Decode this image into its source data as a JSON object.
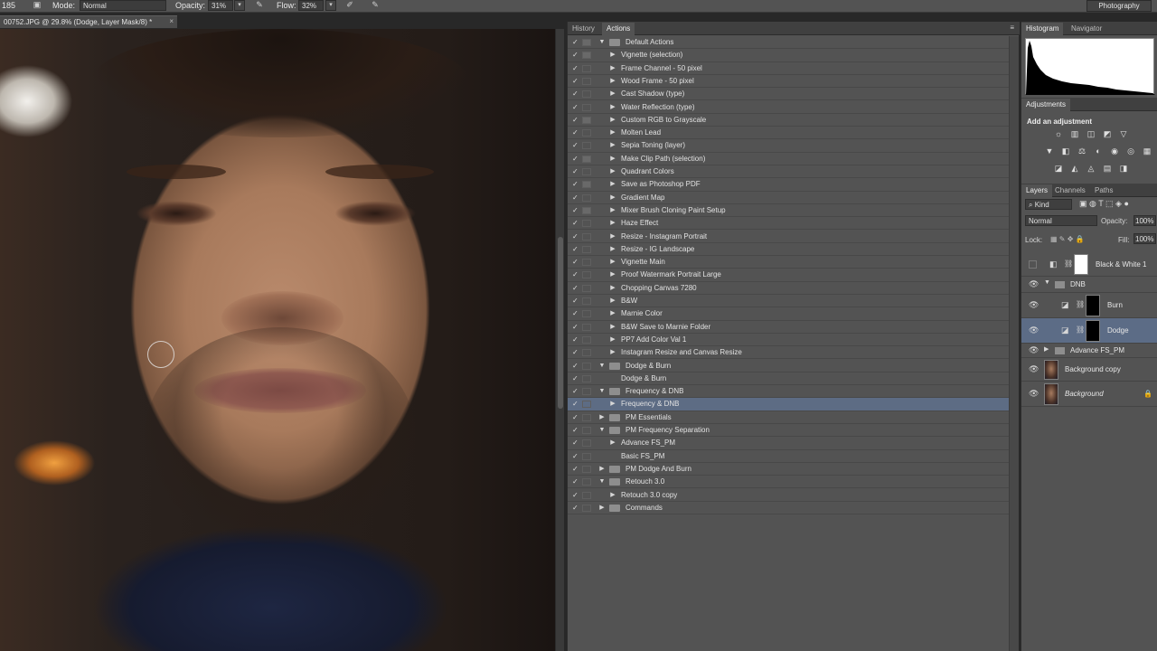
{
  "options_bar": {
    "brush_size": "185",
    "mode_label": "Mode:",
    "mode_value": "Normal",
    "opacity_label": "Opacity:",
    "opacity_value": "31%",
    "flow_label": "Flow:",
    "flow_value": "32%",
    "workspace": "Photography"
  },
  "document": {
    "tab_title": "00752.JPG @ 29.8% (Dodge, Layer Mask/8) *",
    "close": "×"
  },
  "actions_panel": {
    "tabs": [
      "History",
      "Actions"
    ],
    "active_tab": "Actions",
    "menu_icon": "≡",
    "rows": [
      {
        "label": "Default Actions",
        "type": "set",
        "expanded": true,
        "dialog": true
      },
      {
        "label": "Vignette (selection)",
        "type": "action",
        "dialog": true
      },
      {
        "label": "Frame Channel - 50 pixel",
        "type": "action",
        "dialog": false
      },
      {
        "label": "Wood Frame - 50 pixel",
        "type": "action",
        "dialog": false
      },
      {
        "label": "Cast Shadow (type)",
        "type": "action",
        "dialog": false
      },
      {
        "label": "Water Reflection (type)",
        "type": "action",
        "dialog": false
      },
      {
        "label": "Custom RGB to Grayscale",
        "type": "action",
        "dialog": true
      },
      {
        "label": "Molten Lead",
        "type": "action",
        "dialog": false
      },
      {
        "label": "Sepia Toning (layer)",
        "type": "action",
        "dialog": false
      },
      {
        "label": "Make Clip Path (selection)",
        "type": "action",
        "dialog": true
      },
      {
        "label": "Quadrant Colors",
        "type": "action",
        "dialog": false
      },
      {
        "label": "Save as Photoshop PDF",
        "type": "action",
        "dialog": true
      },
      {
        "label": "Gradient Map",
        "type": "action",
        "dialog": false
      },
      {
        "label": "Mixer Brush Cloning Paint Setup",
        "type": "action",
        "dialog": true
      },
      {
        "label": "Haze Effect",
        "type": "action",
        "dialog": false
      },
      {
        "label": "Resize - Instagram Portrait",
        "type": "action",
        "dialog": false
      },
      {
        "label": "Resize - IG Landscape",
        "type": "action",
        "dialog": false
      },
      {
        "label": "Vignette Main",
        "type": "action",
        "dialog": false
      },
      {
        "label": "Proof Watermark Portrait Large",
        "type": "action",
        "dialog": false
      },
      {
        "label": "Chopping Canvas 7280",
        "type": "action",
        "dialog": false
      },
      {
        "label": "B&W",
        "type": "action",
        "dialog": false
      },
      {
        "label": "Marnie Color",
        "type": "action",
        "dialog": false
      },
      {
        "label": "B&W Save to Marnie Folder",
        "type": "action",
        "dialog": false
      },
      {
        "label": "PP7 Add Color Val 1",
        "type": "action",
        "dialog": false
      },
      {
        "label": "Instagram Resize and Canvas Resize",
        "type": "action",
        "dialog": false
      },
      {
        "label": "Dodge & Burn",
        "type": "set",
        "expanded": true,
        "dialog": false
      },
      {
        "label": "Dodge & Burn",
        "type": "action",
        "dialog": false,
        "no_tri": true
      },
      {
        "label": "Frequency & DNB",
        "type": "set",
        "expanded": true,
        "dialog": false
      },
      {
        "label": "Frequency & DNB",
        "type": "action",
        "dialog": false,
        "selected": true
      },
      {
        "label": "PM Essentials",
        "type": "set",
        "expanded": false,
        "dialog": false
      },
      {
        "label": "PM Frequency Separation",
        "type": "set",
        "expanded": true,
        "dialog": false
      },
      {
        "label": "Advance FS_PM",
        "type": "action",
        "dialog": false
      },
      {
        "label": "Basic FS_PM",
        "type": "action",
        "dialog": false,
        "no_tri": true
      },
      {
        "label": "PM Dodge And Burn",
        "type": "set",
        "expanded": false,
        "dialog": false
      },
      {
        "label": "Retouch 3.0",
        "type": "set",
        "expanded": true,
        "dialog": false
      },
      {
        "label": "Retouch 3.0 copy",
        "type": "action",
        "dialog": false
      },
      {
        "label": "Commands",
        "type": "set",
        "expanded": false,
        "dialog": false
      }
    ]
  },
  "histogram_panel": {
    "tabs": [
      "Histogram",
      "Navigator"
    ],
    "active_tab": "Histogram"
  },
  "adjustments_panel": {
    "tab": "Adjustments",
    "title": "Add an adjustment",
    "icons": [
      [
        "brightness-icon",
        "levels-icon",
        "curves-icon",
        "exposure-icon",
        "gradient-icon"
      ],
      [
        "vibrance-icon",
        "hue-sat-icon",
        "color-balance-icon",
        "bw-icon",
        "photo-filter-icon",
        "channel-mixer-icon",
        "color-lookup-icon"
      ],
      [
        "invert-icon",
        "posterize-icon",
        "threshold-icon",
        "gradient-map-icon",
        "selective-color-icon"
      ]
    ]
  },
  "layers_panel": {
    "tabs": [
      "Layers",
      "Channels",
      "Paths"
    ],
    "active_tab": "Layers",
    "kind_label": "Kind",
    "blend_mode": "Normal",
    "opacity_label": "Opacity:",
    "opacity_value": "100%",
    "lock_label": "Lock:",
    "fill_label": "Fill:",
    "fill_value": "100%",
    "layers": [
      {
        "name": "Black & White 1",
        "visible": false,
        "type": "adjustment",
        "indent": false
      },
      {
        "name": "DNB",
        "visible": true,
        "type": "group",
        "indent": false
      },
      {
        "name": "Burn",
        "visible": true,
        "type": "mask",
        "indent": true
      },
      {
        "name": "Dodge",
        "visible": true,
        "type": "mask",
        "indent": true,
        "selected": true
      },
      {
        "name": "Advance FS_PM",
        "visible": true,
        "type": "group-collapsed",
        "indent": false
      },
      {
        "name": "Background copy",
        "visible": true,
        "type": "photo",
        "indent": false
      },
      {
        "name": "Background",
        "visible": true,
        "type": "photo",
        "indent": false,
        "locked": true
      }
    ]
  },
  "colors": {
    "panel_bg": "#535353",
    "selection": "#4c6d9b"
  }
}
